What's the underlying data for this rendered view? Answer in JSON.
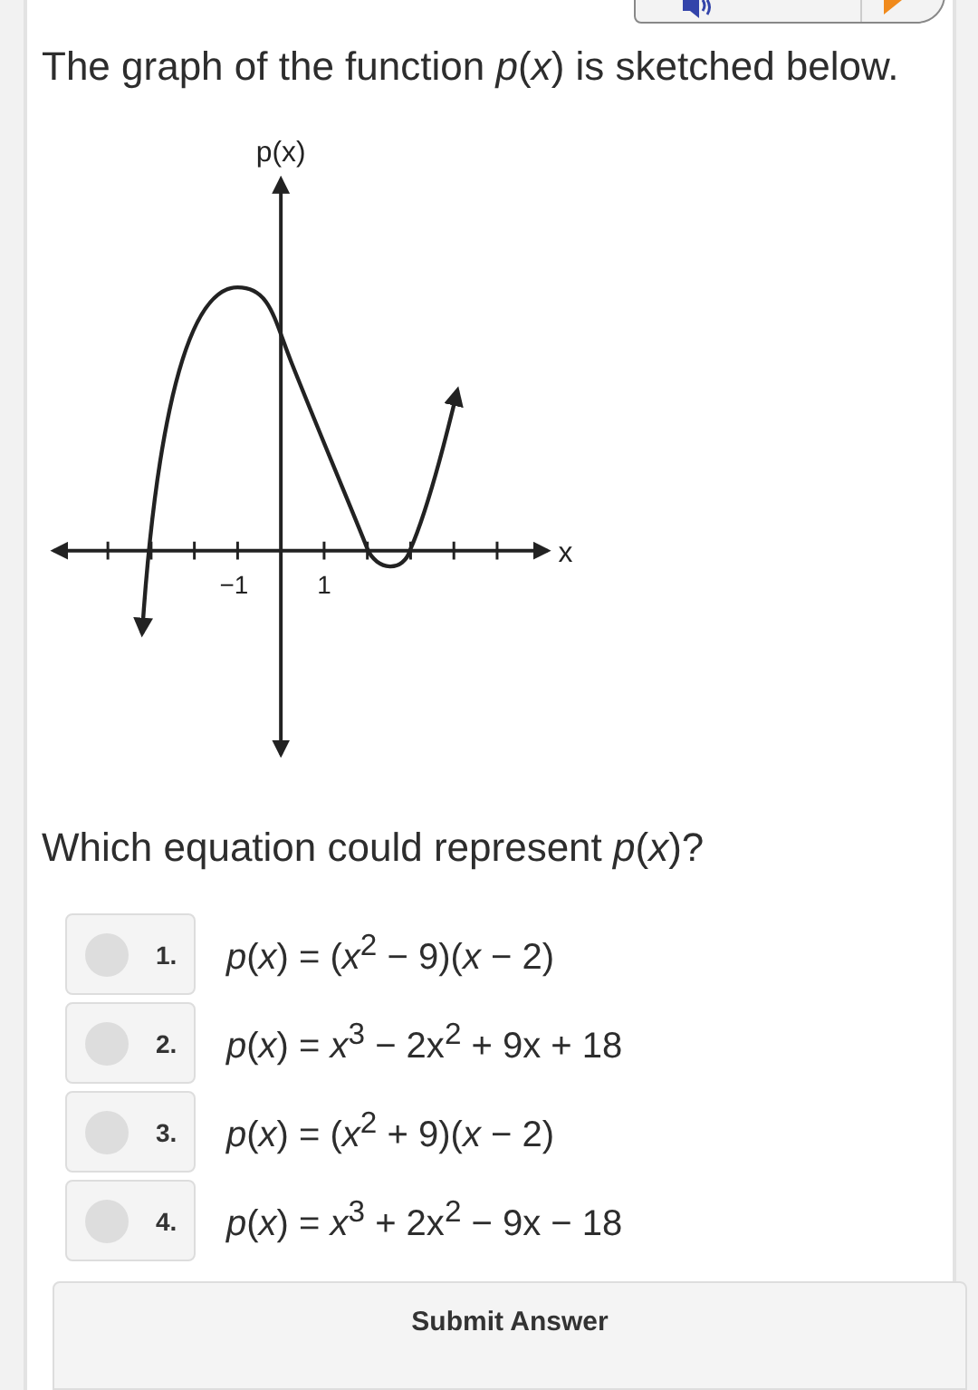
{
  "prompt": "The graph of the function *p*(*x*) is sketched below.",
  "graph": {
    "y_label": "p(x)",
    "x_label": "x",
    "tick_labels": [
      "−1",
      "1"
    ]
  },
  "question": "Which equation could represent *p*(*x*)?",
  "options": [
    {
      "number": "1.",
      "text": "*p*(*x*) = (*x*$^{2}$ − 9)(*x* − 2)",
      "selected": false
    },
    {
      "number": "2.",
      "text": "*p*(*x*) = *x*$^{3}$ − 2x$^{2}$ + 9x + 18",
      "selected": false
    },
    {
      "number": "3.",
      "text": "*p*(*x*) = (*x*$^{2}$ + 9)(*x* − 2)",
      "selected": false
    },
    {
      "number": "4.",
      "text": "*p*(*x*) = *x*$^{3}$ + 2x$^{2}$ − 9x − 18",
      "selected": false
    }
  ],
  "submit": "Submit Answer"
}
